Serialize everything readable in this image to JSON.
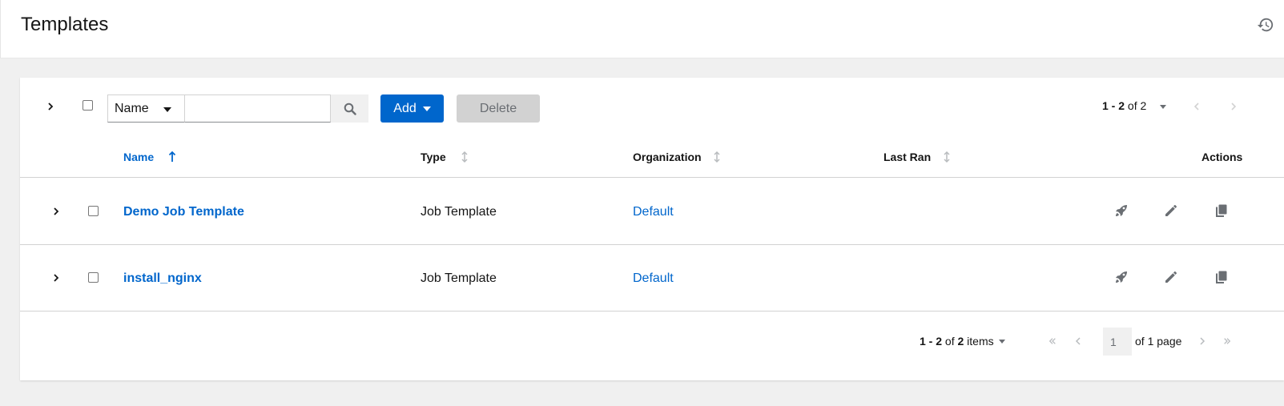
{
  "page": {
    "title": "Templates",
    "history_icon": "history-icon"
  },
  "toolbar": {
    "filter_field": "Name",
    "search_value": "",
    "add_label": "Add",
    "delete_label": "Delete",
    "pagination_prefix": "1 - 2",
    "pagination_suffix": " of 2"
  },
  "table": {
    "columns": [
      {
        "label": "Name",
        "sortable": true,
        "sorted": true
      },
      {
        "label": "Type",
        "sortable": true,
        "sorted": false
      },
      {
        "label": "Organization",
        "sortable": true,
        "sorted": false
      },
      {
        "label": "Last Ran",
        "sortable": true,
        "sorted": false
      },
      {
        "label": "Actions",
        "sortable": false,
        "sorted": false
      }
    ],
    "rows": [
      {
        "name": "Demo Job Template",
        "type": "Job Template",
        "organization": "Default",
        "last_ran": ""
      },
      {
        "name": "install_nginx",
        "type": "Job Template",
        "organization": "Default",
        "last_ran": ""
      }
    ],
    "row_actions": [
      "rocket-icon",
      "pencil-icon",
      "copy-icon"
    ]
  },
  "footer": {
    "count_prefix": "1 - 2",
    "count_middle": " of ",
    "count_total": "2",
    "count_suffix": " items",
    "current_page": "1",
    "of_pages": "of 1 page"
  },
  "colors": {
    "primary": "#0066cc",
    "disabled_bg": "#d2d2d2",
    "page_bg": "#f0f0f0"
  }
}
